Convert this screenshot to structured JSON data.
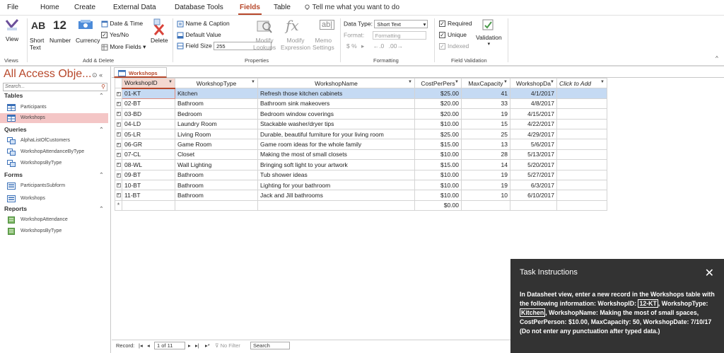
{
  "menu": {
    "items": [
      "File",
      "Home",
      "Create",
      "External Data",
      "Database Tools",
      "Fields",
      "Table"
    ],
    "active": "Fields",
    "tell_me": "Tell me what you want to do"
  },
  "ribbon": {
    "views": {
      "view_label": "View",
      "group": "Views"
    },
    "add_delete": {
      "short_text_icon": "AB",
      "number_icon": "12",
      "short_text": "Short\nText",
      "number": "Number",
      "currency": "Currency",
      "date_time": "Date & Time",
      "yes_no": "Yes/No",
      "more_fields": "More Fields",
      "delete": "Delete",
      "group": "Add & Delete"
    },
    "properties": {
      "name_caption": "Name & Caption",
      "default_value": "Default Value",
      "field_size_label": "Field Size",
      "field_size_value": "255",
      "modify_lookups": "Modify\nLookups",
      "modify_expression": "Modify\nExpression",
      "memo_settings": "Memo\nSettings",
      "group": "Properties"
    },
    "formatting": {
      "data_type_label": "Data Type:",
      "data_type_value": "Short Text",
      "format_label": "Format:",
      "format_value": "Formatting",
      "currency_symbols": "$ %",
      "group": "Formatting"
    },
    "validation": {
      "required": "Required",
      "unique": "Unique",
      "indexed": "Indexed",
      "validation": "Validation",
      "group": "Field Validation"
    }
  },
  "nav": {
    "title": "All Access Obje...",
    "search_placeholder": "Search...",
    "sections": [
      {
        "name": "Tables",
        "items": [
          "Participants",
          "Workshops"
        ]
      },
      {
        "name": "Queries",
        "items": [
          "AlphaListOfCustomers",
          "WorkshopAttendanceByType",
          "WorkshopsByType"
        ]
      },
      {
        "name": "Forms",
        "items": [
          "ParticipantsSubform",
          "Workshops"
        ]
      },
      {
        "name": "Reports",
        "items": [
          "WorkshopAttendance",
          "WorkshopsByType"
        ]
      }
    ],
    "selected": "Workshops"
  },
  "document": {
    "tab": "Workshops",
    "columns": [
      "WorkshopID",
      "WorkshopType",
      "WorkshopName",
      "CostPerPers",
      "MaxCapacity",
      "WorkshopDa",
      "Click to Add"
    ],
    "rows": [
      [
        "01-KT",
        "Kitchen",
        "Refresh those kitchen cabinets",
        "$25.00",
        "41",
        "4/1/2017"
      ],
      [
        "02-BT",
        "Bathroom",
        "Bathroom sink makeovers",
        "$20.00",
        "33",
        "4/8/2017"
      ],
      [
        "03-BD",
        "Bedroom",
        "Bedroom window coverings",
        "$20.00",
        "19",
        "4/15/2017"
      ],
      [
        "04-LD",
        "Laundry Room",
        "Stackable washer/dryer tips",
        "$10.00",
        "15",
        "4/22/2017"
      ],
      [
        "05-LR",
        "Living Room",
        "Durable, beautiful furniture for your living room",
        "$25.00",
        "25",
        "4/29/2017"
      ],
      [
        "06-GR",
        "Game Room",
        "Game room ideas for the whole family",
        "$15.00",
        "13",
        "5/6/2017"
      ],
      [
        "07-CL",
        "Closet",
        "Making the most of small closets",
        "$10.00",
        "28",
        "5/13/2017"
      ],
      [
        "08-WL",
        "Wall Lighting",
        "Bringing soft light to your artwork",
        "$15.00",
        "14",
        "5/20/2017"
      ],
      [
        "09-BT",
        "Bathroom",
        "Tub shower ideas",
        "$10.00",
        "19",
        "5/27/2017"
      ],
      [
        "10-BT",
        "Bathroom",
        "Lighting for your bathroom",
        "$10.00",
        "19",
        "6/3/2017"
      ],
      [
        "11-BT",
        "Bathroom",
        "Jack and Jill bathrooms",
        "$10.00",
        "10",
        "6/10/2017"
      ]
    ],
    "new_row_cost": "$0.00"
  },
  "record_bar": {
    "record_label": "Record:",
    "position": "1 of 11",
    "no_filter": "No Filter",
    "search": "Search"
  },
  "task": {
    "title": "Task Instructions",
    "intro": "In Datasheet view, enter a new record in the Workshops table with the following information: WorkshopID:",
    "workshop_id": "12-KT",
    "type_label": ", WorkshopType:",
    "workshop_type": "Kitchen",
    "name_label": ", WorkshopName:",
    "workshop_name": "Making the most of small spaces",
    "cost_label": ", CostPerPerson:",
    "cost": "$10.00",
    "capacity_label": ", MaxCapacity:",
    "capacity": "50",
    "date_label": ", WorkshopDate:",
    "date": "7/10/17",
    "outro": "(Do not enter any punctuation after typed data.)"
  },
  "colors": {
    "accent": "#b7472a",
    "row_highlight": "#c5daf3",
    "task_bg": "#333333"
  }
}
